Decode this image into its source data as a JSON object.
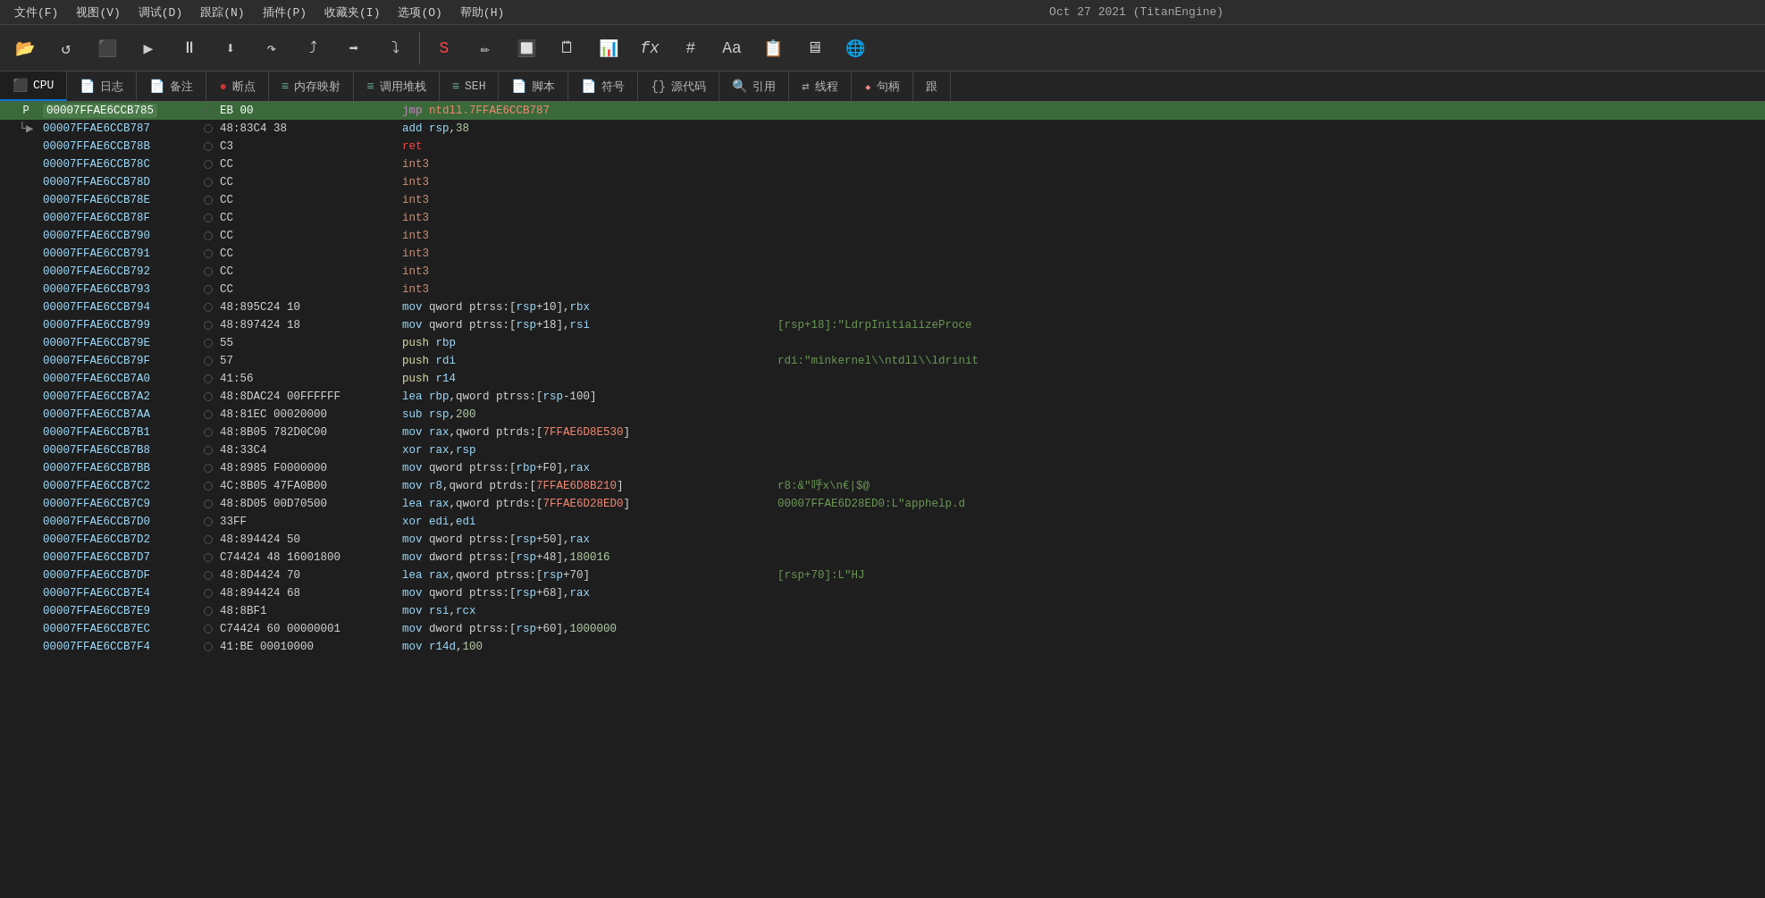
{
  "title": "Oct 27 2021 (TitanEngine)",
  "menubar": {
    "items": [
      {
        "label": "文件(F)"
      },
      {
        "label": "视图(V)"
      },
      {
        "label": "调试(D)"
      },
      {
        "label": "跟踪(N)"
      },
      {
        "label": "插件(P)"
      },
      {
        "label": "收藏夹(I)"
      },
      {
        "label": "选项(O)"
      },
      {
        "label": "帮助(H)"
      }
    ]
  },
  "tabs": [
    {
      "label": "CPU",
      "active": true,
      "icon": "⬛"
    },
    {
      "label": "日志",
      "active": false,
      "icon": "📄"
    },
    {
      "label": "备注",
      "active": false,
      "icon": "📄"
    },
    {
      "label": "断点",
      "active": false,
      "icon": "🔴"
    },
    {
      "label": "内存映射",
      "active": false,
      "icon": "📋"
    },
    {
      "label": "调用堆栈",
      "active": false,
      "icon": "📋"
    },
    {
      "label": "SEH",
      "active": false,
      "icon": "📋"
    },
    {
      "label": "脚本",
      "active": false,
      "icon": "📄"
    },
    {
      "label": "符号",
      "active": false,
      "icon": "📄"
    },
    {
      "label": "源代码",
      "active": false,
      "icon": "{}"
    },
    {
      "label": "引用",
      "active": false,
      "icon": "🔍"
    },
    {
      "label": "线程",
      "active": false,
      "icon": "🔀"
    },
    {
      "label": "句柄",
      "active": false,
      "icon": "🔧"
    },
    {
      "label": "跟",
      "active": false,
      "icon": ""
    }
  ],
  "disasm": {
    "rows": [
      {
        "addr": "00007FFAE6CCB785",
        "bp": false,
        "arrow": "current",
        "hex": "EB 00",
        "mnemonic": "jmp",
        "operands": "ntdll.7FFAE6CCB787",
        "comment": "",
        "active": true
      },
      {
        "addr": "00007FFAE6CCB787",
        "bp": false,
        "arrow": "follow",
        "hex": "48:83C4 38",
        "mnemonic": "add",
        "operands": "rsp,38",
        "comment": ""
      },
      {
        "addr": "00007FFAE6CCB78B",
        "bp": false,
        "arrow": "",
        "hex": "C3",
        "mnemonic": "ret",
        "operands": "",
        "comment": ""
      },
      {
        "addr": "00007FFAE6CCB78C",
        "bp": false,
        "arrow": "",
        "hex": "CC",
        "mnemonic": "int3",
        "operands": "",
        "comment": ""
      },
      {
        "addr": "00007FFAE6CCB78D",
        "bp": false,
        "arrow": "",
        "hex": "CC",
        "mnemonic": "int3",
        "operands": "",
        "comment": ""
      },
      {
        "addr": "00007FFAE6CCB78E",
        "bp": false,
        "arrow": "",
        "hex": "CC",
        "mnemonic": "int3",
        "operands": "",
        "comment": ""
      },
      {
        "addr": "00007FFAE6CCB78F",
        "bp": false,
        "arrow": "",
        "hex": "CC",
        "mnemonic": "int3",
        "operands": "",
        "comment": ""
      },
      {
        "addr": "00007FFAE6CCB790",
        "bp": false,
        "arrow": "",
        "hex": "CC",
        "mnemonic": "int3",
        "operands": "",
        "comment": ""
      },
      {
        "addr": "00007FFAE6CCB791",
        "bp": false,
        "arrow": "",
        "hex": "CC",
        "mnemonic": "int3",
        "operands": "",
        "comment": ""
      },
      {
        "addr": "00007FFAE6CCB792",
        "bp": false,
        "arrow": "",
        "hex": "CC",
        "mnemonic": "int3",
        "operands": "",
        "comment": ""
      },
      {
        "addr": "00007FFAE6CCB793",
        "bp": false,
        "arrow": "",
        "hex": "CC",
        "mnemonic": "int3",
        "operands": "",
        "comment": ""
      },
      {
        "addr": "00007FFAE6CCB794",
        "bp": false,
        "arrow": "",
        "hex": "48:895C24 10",
        "mnemonic": "mov",
        "operands": "qword ptrss:[rsp+10],rbx",
        "comment": ""
      },
      {
        "addr": "00007FFAE6CCB799",
        "bp": false,
        "arrow": "",
        "hex": "48:897424 18",
        "mnemonic": "mov",
        "operands": "qword ptrss:[rsp+18],rsi",
        "comment": "[rsp+18]:\"LdrpInitializeProce"
      },
      {
        "addr": "00007FFAE6CCB79E",
        "bp": false,
        "arrow": "",
        "hex": "55",
        "mnemonic": "push",
        "operands": "rbp",
        "comment": ""
      },
      {
        "addr": "00007FFAE6CCB79F",
        "bp": false,
        "arrow": "",
        "hex": "57",
        "mnemonic": "push",
        "operands": "rdi",
        "comment": "rdi:\"minkernel\\\\ntdll\\\\ldrinit"
      },
      {
        "addr": "00007FFAE6CCB7A0",
        "bp": false,
        "arrow": "",
        "hex": "41:56",
        "mnemonic": "push",
        "operands": "r14",
        "comment": ""
      },
      {
        "addr": "00007FFAE6CCB7A2",
        "bp": false,
        "arrow": "",
        "hex": "48:8DAC24 00FFFFFF",
        "mnemonic": "lea",
        "operands": "rbp,qword ptrss:[rsp-100]",
        "comment": ""
      },
      {
        "addr": "00007FFAE6CCB7AA",
        "bp": false,
        "arrow": "",
        "hex": "48:81EC 00020000",
        "mnemonic": "sub",
        "operands": "rsp,200",
        "comment": ""
      },
      {
        "addr": "00007FFAE6CCB7B1",
        "bp": false,
        "arrow": "",
        "hex": "48:8B05 782D0C00",
        "mnemonic": "mov",
        "operands": "rax,qword ptrds:[7FFAE6D8E530]",
        "comment": ""
      },
      {
        "addr": "00007FFAE6CCB7B8",
        "bp": false,
        "arrow": "",
        "hex": "48:33C4",
        "mnemonic": "xor",
        "operands": "rax,rsp",
        "comment": ""
      },
      {
        "addr": "00007FFAE6CCB7BB",
        "bp": false,
        "arrow": "",
        "hex": "48:8985 F0000000",
        "mnemonic": "mov",
        "operands": "qword ptrss:[rbp+F0],rax",
        "comment": ""
      },
      {
        "addr": "00007FFAE6CCB7C2",
        "bp": false,
        "arrow": "",
        "hex": "4C:8B05 47FA0B00",
        "mnemonic": "mov",
        "operands": "r8,qword ptrds:[7FFAE6D8B210]",
        "comment": "r8:&\"呼x\\n€|$@"
      },
      {
        "addr": "00007FFAE6CCB7C9",
        "bp": false,
        "arrow": "",
        "hex": "48:8D05 00D70500",
        "mnemonic": "lea",
        "operands": "rax,qword ptrds:[7FFAE6D28ED0]",
        "comment": "00007FFAE6D28ED0:L\"apphelp.d"
      },
      {
        "addr": "00007FFAE6CCB7D0",
        "bp": false,
        "arrow": "",
        "hex": "33FF",
        "mnemonic": "xor",
        "operands": "edi,edi",
        "comment": ""
      },
      {
        "addr": "00007FFAE6CCB7D2",
        "bp": false,
        "arrow": "",
        "hex": "48:894424 50",
        "mnemonic": "mov",
        "operands": "qword ptrss:[rsp+50],rax",
        "comment": ""
      },
      {
        "addr": "00007FFAE6CCB7D7",
        "bp": false,
        "arrow": "",
        "hex": "C74424 48 16001800",
        "mnemonic": "mov",
        "operands": "dword ptrss:[rsp+48],180016",
        "comment": ""
      },
      {
        "addr": "00007FFAE6CCB7DF",
        "bp": false,
        "arrow": "",
        "hex": "48:8D4424 70",
        "mnemonic": "lea",
        "operands": "rax,qword ptrss:[rsp+70]",
        "comment": "[rsp+70]:L\"HJ"
      },
      {
        "addr": "00007FFAE6CCB7E4",
        "bp": false,
        "arrow": "",
        "hex": "48:894424 68",
        "mnemonic": "mov",
        "operands": "qword ptrss:[rsp+68],rax",
        "comment": ""
      },
      {
        "addr": "00007FFAE6CCB7E9",
        "bp": false,
        "arrow": "",
        "hex": "48:8BF1",
        "mnemonic": "mov",
        "operands": "rsi,rcx",
        "comment": ""
      },
      {
        "addr": "00007FFAE6CCB7EC",
        "bp": false,
        "arrow": "",
        "hex": "C74424 60 00000001",
        "mnemonic": "mov",
        "operands": "dword ptrss:[rsp+60],1000000",
        "comment": ""
      },
      {
        "addr": "00007FFAE6CCB7F4",
        "bp": false,
        "arrow": "",
        "hex": "41:BE 00010000",
        "mnemonic": "mov",
        "operands": "r14d,100",
        "comment": ""
      }
    ]
  }
}
